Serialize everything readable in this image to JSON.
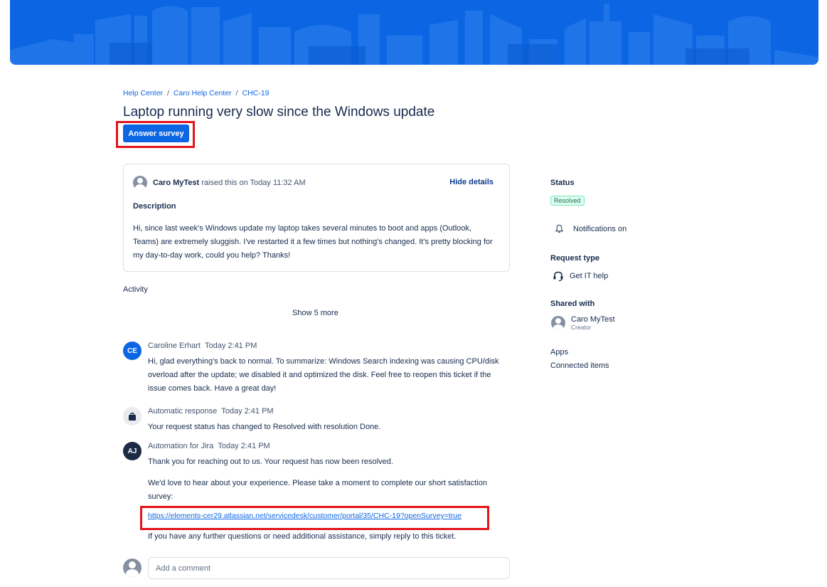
{
  "breadcrumb": {
    "items": [
      "Help Center",
      "Caro Help Center",
      "CHC-19"
    ],
    "sep": "/"
  },
  "request": {
    "title": "Laptop running very slow since the Windows update",
    "survey_button": "Answer survey"
  },
  "details": {
    "raiser_name": "Caro MyTest",
    "raised_text": "raised this on Today 11:32 AM",
    "hide_details": "Hide details",
    "description_heading": "Description",
    "description_lines": [
      "Hi, since last week's Windows update my laptop takes several minutes to boot and apps (Outlook,",
      "Teams) are extremely sluggish. I've restarted it a few times but nothing's changed. It's pretty blocking for",
      "my day-to-day work, could you help? Thanks!"
    ]
  },
  "activity": {
    "heading": "Activity",
    "show_more": "Show 5 more",
    "entries": [
      {
        "initials": "CE",
        "avatar_color": "#0c66e4",
        "author": "Caroline Erhart",
        "time": "Today 2:41 PM",
        "lines": [
          "Hi, glad everything's back to normal. To summarize: Windows Search indexing was causing CPU/disk",
          "overload after the update; we disabled it and optimized the disk. Feel free to reopen this ticket if the",
          "issue comes back. Have a great day!"
        ]
      },
      {
        "icon": "bag-icon",
        "avatar_color": "#e9ebee",
        "author": "Automatic response",
        "time": "Today 2:41 PM",
        "lines": [
          "Your request status has changed to Resolved with resolution Done."
        ]
      },
      {
        "initials": "AJ",
        "avatar_color": "#1d2a44",
        "author": "Automation for Jira",
        "time": "Today 2:41 PM",
        "line1": "Thank you for reaching out to us. Your request has now been resolved.",
        "line2a": "We'd love to hear about your experience. Please take a moment to complete our short satisfaction",
        "line2b": "survey:",
        "link": "https://elements-cer29.atlassian.net/servicedesk/customer/portal/35/CHC-19?openSurvey=true",
        "line3": "If you have any further questions or need additional assistance, simply reply to this ticket."
      }
    ]
  },
  "comment": {
    "placeholder": "Add a comment"
  },
  "sidebar": {
    "status_heading": "Status",
    "status_value": "Resolved",
    "notifications": "Notifications on",
    "request_type_heading": "Request type",
    "request_type_value": "Get IT help",
    "shared_heading": "Shared with",
    "shared_name": "Caro MyTest",
    "shared_role": "Creator",
    "apps_heading": "Apps",
    "connected_items": "Connected items"
  },
  "colors": {
    "brand": "#0c66e4",
    "highlight": "#e2141a",
    "resolved_bg": "#dcfff1"
  }
}
